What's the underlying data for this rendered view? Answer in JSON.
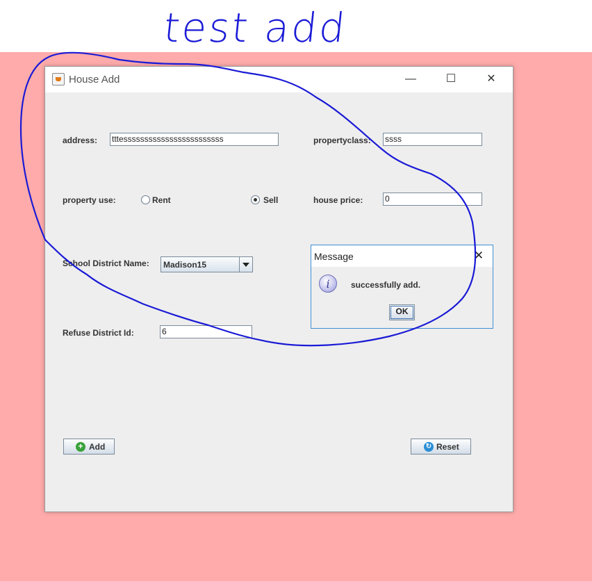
{
  "annotation": {
    "handwriting": "test add"
  },
  "window": {
    "title": "House Add",
    "controls": {
      "minimize": "—",
      "maximize": "☐",
      "close": "✕"
    }
  },
  "form": {
    "address_label": "address:",
    "address_value": "tttessssssssssssssssssssssss",
    "propertyclass_label": "propertyclass:",
    "propertyclass_value": "ssss",
    "property_use_label": "property use:",
    "radio_rent": "Rent",
    "radio_sell": "Sell",
    "selected_use": "Sell",
    "house_price_label": "house price:",
    "house_price_value": "0",
    "school_label": "School District Name:",
    "school_value": "Madison15",
    "refuse_label": "Refuse District Id:",
    "refuse_value": "6",
    "add_button": "Add",
    "reset_button": "Reset"
  },
  "dialog": {
    "title": "Message",
    "message": "successfully add.",
    "ok_button": "OK",
    "close": "✕",
    "info_glyph": "i"
  },
  "icons": {
    "add": "plus-circle-icon",
    "reset": "refresh-icon",
    "info": "information-icon"
  },
  "colors": {
    "background": "#ffabab",
    "annotation_ink": "#1a1ad6",
    "dialog_border": "#3f8fd2"
  }
}
